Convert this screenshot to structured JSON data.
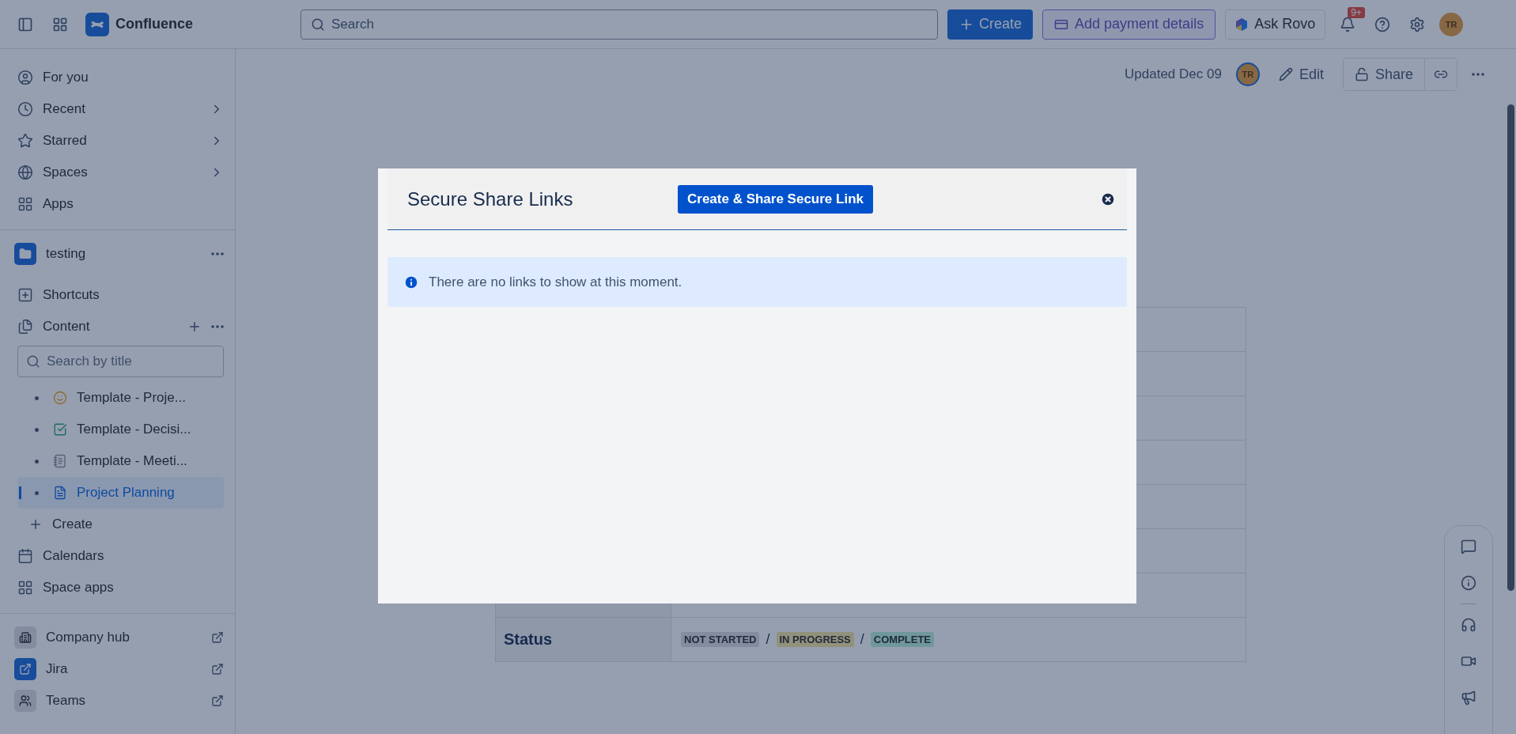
{
  "topbar": {
    "product": "Confluence",
    "search": {
      "placeholder": "Search"
    },
    "create": "Create",
    "payment": "Add payment details",
    "rovo": "Ask Rovo",
    "notifications_badge": "9+",
    "avatar": "TR"
  },
  "page_header": {
    "updated": "Updated Dec 09",
    "avatar": "TR",
    "edit": "Edit",
    "share": "Share"
  },
  "sidebar": {
    "nav": [
      {
        "label": "For you",
        "chevron": false
      },
      {
        "label": "Recent",
        "chevron": true
      },
      {
        "label": "Starred",
        "chevron": true
      },
      {
        "label": "Spaces",
        "chevron": true
      },
      {
        "label": "Apps",
        "chevron": false
      }
    ],
    "space": {
      "name": "testing"
    },
    "space_nav": [
      {
        "label": "Shortcuts",
        "actions": false
      },
      {
        "label": "Content",
        "actions": true
      }
    ],
    "search": {
      "placeholder": "Search by title"
    },
    "tree": [
      {
        "label": "Template - Proje...",
        "selected": false
      },
      {
        "label": "Template - Decisi...",
        "selected": false
      },
      {
        "label": "Template - Meeti...",
        "selected": false
      },
      {
        "label": "Project Planning",
        "selected": true
      }
    ],
    "create": "Create",
    "space_links": [
      {
        "label": "Calendars"
      },
      {
        "label": "Space apps"
      }
    ],
    "apps": [
      {
        "label": "Company hub"
      },
      {
        "label": "Jira"
      },
      {
        "label": "Teams"
      }
    ]
  },
  "table": {
    "status_label": "Status",
    "status_parts": [
      {
        "kind": "neutral",
        "label": "NOT STARTED"
      },
      {
        "kind": "separator",
        "label": "/"
      },
      {
        "kind": "progress",
        "label": "IN PROGRESS"
      },
      {
        "kind": "separator",
        "label": "/"
      },
      {
        "kind": "success",
        "label": "COMPLETE"
      }
    ]
  },
  "modal": {
    "title": "Secure Share Links",
    "button": "Create & Share Secure Link",
    "message": "There are no links to show at this moment."
  }
}
